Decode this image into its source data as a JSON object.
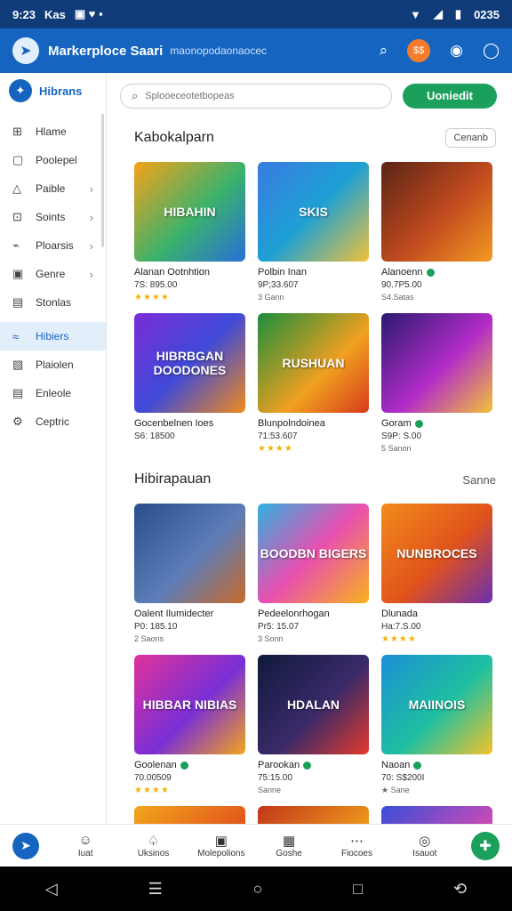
{
  "status_bar": {
    "time": "9:23",
    "carrier": "Kas",
    "battery_text": "0235"
  },
  "app_bar": {
    "title": "Markerploce Saari",
    "subtitle": "maonopodaonaocec",
    "badge": "$$"
  },
  "sidebar": {
    "header": "Hibrans",
    "items": [
      {
        "label": "Hlame",
        "icon": "grid-icon",
        "chev": ""
      },
      {
        "label": "Poolepel",
        "icon": "box-icon",
        "chev": ""
      },
      {
        "label": "Paible",
        "icon": "triangle-icon",
        "chev": "›"
      },
      {
        "label": "Soints",
        "icon": "tag-icon",
        "chev": "›"
      },
      {
        "label": "Ploarsis",
        "icon": "bolt-icon",
        "chev": "›"
      },
      {
        "label": "Genre",
        "icon": "genre-icon",
        "chev": "›"
      },
      {
        "label": "Stonlas",
        "icon": "calendar-icon",
        "chev": ""
      },
      {
        "label": "Hibiers",
        "icon": "hiber-icon",
        "chev": "",
        "active": true
      },
      {
        "label": "Plaiolen",
        "icon": "doc-icon",
        "chev": ""
      },
      {
        "label": "Enleole",
        "icon": "list-icon",
        "chev": ""
      },
      {
        "label": "Ceptric",
        "icon": "gear-icon",
        "chev": ""
      }
    ]
  },
  "search": {
    "placeholder": "Splooeceotetbopeas"
  },
  "cta_label": "Uoniedit",
  "section1": {
    "title": "Kabokalparn",
    "button": "Cenanb",
    "cards": [
      {
        "title": "HIBAHIN",
        "name": "Alanan Ootnhtion",
        "price": "7S: 895.00",
        "meta": "",
        "stars": "★★★★",
        "verified": false,
        "gradient": "linear-gradient(135deg,#f6a21a,#3bb26a 55%,#2870d8)"
      },
      {
        "title": "SKIS",
        "name": "Polbin Inan",
        "price": "9P;33.607",
        "meta": "3 Gann",
        "stars": "",
        "verified": false,
        "gradient": "linear-gradient(135deg,#3a7be0,#1ea0d4 50%,#f0c23a)"
      },
      {
        "title": "",
        "name": "Alanoenn",
        "price": "90.7P5.00",
        "meta": "S4.Satas",
        "stars": "",
        "verified": true,
        "gradient": "linear-gradient(135deg,#5a2416,#c14b1e 55%,#f39a23)"
      },
      {
        "title": "HIBRBGAN DOODONES",
        "name": "Gocenbelnen Ioes",
        "price": "S6: 18500",
        "meta": "",
        "stars": "",
        "verified": false,
        "gradient": "linear-gradient(135deg,#7b2bd6,#3f4ad8 50%,#ef8a1c)"
      },
      {
        "title": "RUSHUAN",
        "name": "Blunpolndoinea",
        "price": "71:53.607",
        "meta": "",
        "stars": "★★★★",
        "verified": false,
        "gradient": "linear-gradient(135deg,#1b8e3c,#f0a020 60%,#d63a1a)"
      },
      {
        "title": "",
        "name": "Goram",
        "price": "S9P: S.00",
        "meta": "5 Sanon",
        "stars": "",
        "verified": true,
        "gradient": "linear-gradient(135deg,#2a1b6e,#b22cc9 55%,#f2c33a)"
      }
    ]
  },
  "section2": {
    "title": "Hibirapauan",
    "link": "Sanne",
    "cards": [
      {
        "title": "",
        "name": "Oalent Ilumidecter",
        "price": "P0: 185.10",
        "meta": "2 Saons",
        "stars": "",
        "verified": false,
        "gradient": "linear-gradient(135deg,#2a4e8a,#5c7db8 55%,#c86a2a)"
      },
      {
        "title": "BOODBN BIGERS",
        "name": "Pedeelonrhogan",
        "price": "Pr5: 15.07",
        "meta": "3 Sonn",
        "stars": "",
        "verified": false,
        "gradient": "linear-gradient(135deg,#2fb0e0,#e84fb0 50%,#f7b21c)"
      },
      {
        "title": "NUNBROCES",
        "name": "Dlunada",
        "price": "Ha:7.S.00",
        "meta": "",
        "stars": "★★★★",
        "verified": false,
        "gradient": "linear-gradient(135deg,#f28b1c,#e0521c 55%,#6a2fb0)"
      },
      {
        "title": "HIBBAR NIBIAS",
        "name": "Goolenan",
        "price": "70.00509",
        "meta": "",
        "stars": "★★★★",
        "verified": true,
        "gradient": "linear-gradient(135deg,#e0329a,#7a2fd6 55%,#f2a51c)"
      },
      {
        "title": "HDALAN",
        "name": "Parookan",
        "price": "75:15.00",
        "meta": "Sanne",
        "stars": "",
        "verified": true,
        "gradient": "linear-gradient(135deg,#0f1a3a,#3a2a6a 55%,#e23a2a)"
      },
      {
        "title": "MAIINOIS",
        "name": "Naoan",
        "price": "70: S$200I",
        "meta": "★ Sane",
        "stars": "",
        "verified": true,
        "gradient": "linear-gradient(135deg,#1b8fd6,#1fc0a0 55%,#f5c22a)"
      }
    ]
  },
  "bottom_nav": {
    "items": [
      {
        "label": "Iuat",
        "icon": "user-icon"
      },
      {
        "label": "Uksinos",
        "icon": "leaf-icon"
      },
      {
        "label": "Molepolions",
        "icon": "shop-icon"
      },
      {
        "label": "Goshe",
        "icon": "card-icon"
      },
      {
        "label": "Fiocoes",
        "icon": "dots-icon"
      },
      {
        "label": "Isauot",
        "icon": "circle-icon"
      }
    ]
  }
}
